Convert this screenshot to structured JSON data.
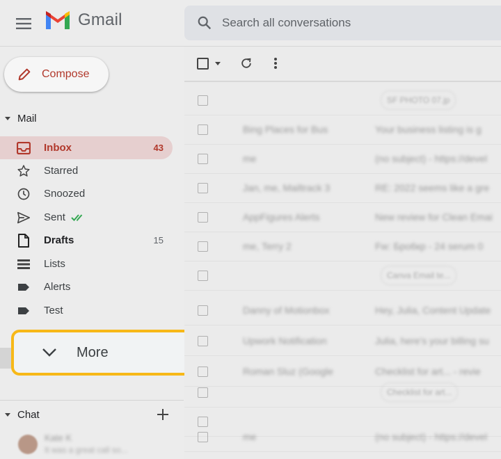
{
  "header": {
    "app_name": "Gmail",
    "search_placeholder": "Search all conversations"
  },
  "compose": {
    "label": "Compose"
  },
  "mail_section": {
    "label": "Mail"
  },
  "nav": {
    "inbox": {
      "label": "Inbox",
      "count": "43"
    },
    "starred": {
      "label": "Starred"
    },
    "snoozed": {
      "label": "Snoozed"
    },
    "sent": {
      "label": "Sent"
    },
    "drafts": {
      "label": "Drafts",
      "count": "15"
    },
    "lists": {
      "label": "Lists"
    },
    "alerts": {
      "label": "Alerts"
    },
    "test": {
      "label": "Test"
    }
  },
  "more": {
    "label": "More"
  },
  "chat_section": {
    "label": "Chat"
  },
  "chat_contact": {
    "name": "Kate K",
    "preview": "It was a great call so..."
  },
  "emails": [
    {
      "sender": "",
      "subject": "",
      "chip": "SF PHOTO 07.jp"
    },
    {
      "sender": "Bing Places for Bus",
      "subject": "Your business listing is g"
    },
    {
      "sender": "me",
      "subject": "(no subject) - https://devel"
    },
    {
      "sender": "Jan, me, Mailtrack 3",
      "subject": "RE: 2022 seems like a gre"
    },
    {
      "sender": "AppFigures Alerts",
      "subject": "New review for Clean Emai"
    },
    {
      "sender": "me, Terry 2",
      "subject": "Fw: Бpo6кр - 24 serum 0"
    },
    {
      "sender": "",
      "subject": "",
      "chip": "Canva Email te..."
    },
    {
      "sender": "Danny of Motionbox",
      "subject": "Hey, Julia, Content Update"
    },
    {
      "sender": "Upwork Notification",
      "subject": "Julia, here's your billing su"
    },
    {
      "sender": "Roman Sluz (Google",
      "subject": "Checklist for art... - revie"
    },
    {
      "sender": "",
      "subject": "",
      "chip": "Checklist for art..."
    },
    {
      "sender": "",
      "subject": ""
    },
    {
      "sender": "me",
      "subject": "(no subject) - https://devel"
    }
  ],
  "colors": {
    "accent_red": "#b1382b",
    "highlight": "#f7b818",
    "sent_check": "#34a853"
  }
}
